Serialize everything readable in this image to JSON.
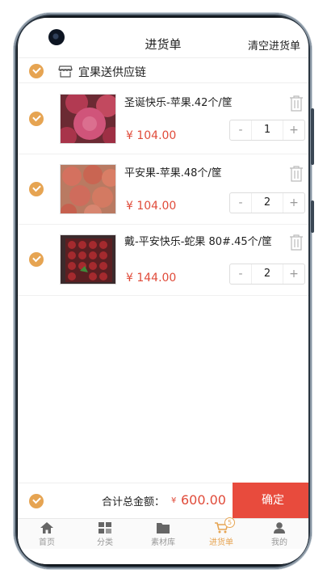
{
  "header": {
    "title": "进货单",
    "clear_label": "清空进货单"
  },
  "supplier": {
    "name": "宜果送供应链"
  },
  "items": [
    {
      "name": "圣诞快乐-苹果.42个/筐",
      "price": "¥ 104.00",
      "qty": "1"
    },
    {
      "name": "平安果-苹果.48个/筐",
      "price": "¥ 104.00",
      "qty": "2"
    },
    {
      "name": "戴-平安快乐-蛇果 80#.45个/筐",
      "price": "¥ 144.00",
      "qty": "2"
    }
  ],
  "stepper": {
    "minus": "-",
    "plus": "+"
  },
  "footer": {
    "total_label": "合计总金额：",
    "currency": "¥",
    "total": "600.00",
    "confirm_label": "确定"
  },
  "tabs": [
    {
      "label": "首页",
      "icon": "home-icon"
    },
    {
      "label": "分类",
      "icon": "category-icon"
    },
    {
      "label": "素材库",
      "icon": "folder-icon"
    },
    {
      "label": "进货单",
      "icon": "cart-icon",
      "badge": "5",
      "active": true
    },
    {
      "label": "我的",
      "icon": "user-icon"
    }
  ],
  "colors": {
    "accent": "#e6a452",
    "price": "#e04b3a",
    "confirm": "#e84b3d"
  }
}
